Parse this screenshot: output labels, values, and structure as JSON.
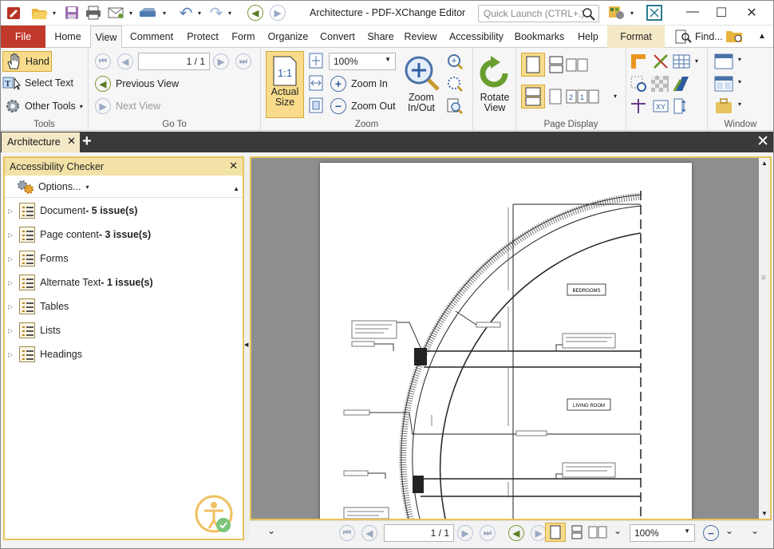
{
  "app": {
    "title": "Architecture - PDF-XChange Editor",
    "quick_launch_placeholder": "Quick Launch (CTRL+.)"
  },
  "menu_tabs": [
    {
      "label": "File"
    },
    {
      "label": "Home"
    },
    {
      "label": "View"
    },
    {
      "label": "Comment"
    },
    {
      "label": "Protect"
    },
    {
      "label": "Form"
    },
    {
      "label": "Organize"
    },
    {
      "label": "Convert"
    },
    {
      "label": "Share"
    },
    {
      "label": "Review"
    },
    {
      "label": "Accessibility"
    },
    {
      "label": "Bookmarks"
    },
    {
      "label": "Help"
    },
    {
      "label": "Format"
    }
  ],
  "find_label": "Find...",
  "ribbon": {
    "tools": {
      "label": "Tools",
      "hand": "Hand",
      "select_text": "Select Text",
      "other_tools": "Other Tools"
    },
    "goto": {
      "label": "Go To",
      "page_value": "1 / 1",
      "previous_view": "Previous View",
      "next_view": "Next View"
    },
    "zoom": {
      "label": "Zoom",
      "actual_size_line1": "Actual",
      "actual_size_line2": "Size",
      "zoom_value": "100%",
      "zoom_in": "Zoom In",
      "zoom_out": "Zoom Out",
      "zoom_inout_line1": "Zoom",
      "zoom_inout_line2": "In/Out"
    },
    "rotate": {
      "line1": "Rotate",
      "line2": "View"
    },
    "page_display": {
      "label": "Page Display"
    },
    "window": {
      "label": "Window"
    }
  },
  "doc_tab": {
    "name": "Architecture"
  },
  "panel": {
    "title": "Accessibility Checker",
    "options": "Options...",
    "items": [
      {
        "name": "Document",
        "issues": " - 5 issue(s)"
      },
      {
        "name": "Page content",
        "issues": " - 3 issue(s)"
      },
      {
        "name": "Forms",
        "issues": ""
      },
      {
        "name": "Alternate Text",
        "issues": " - 1 issue(s)"
      },
      {
        "name": "Tables",
        "issues": ""
      },
      {
        "name": "Lists",
        "issues": ""
      },
      {
        "name": "Headings",
        "issues": ""
      }
    ]
  },
  "drawing": {
    "label_bedrooms": "BEDROOMS",
    "label_living": "LIVING ROOM"
  },
  "statusbar": {
    "page_value": "1 / 1",
    "zoom_value": "100%"
  },
  "colors": {
    "file_tab": "#c0392b",
    "accent_yellow": "#e6c35c",
    "green": "#5b7d25"
  }
}
